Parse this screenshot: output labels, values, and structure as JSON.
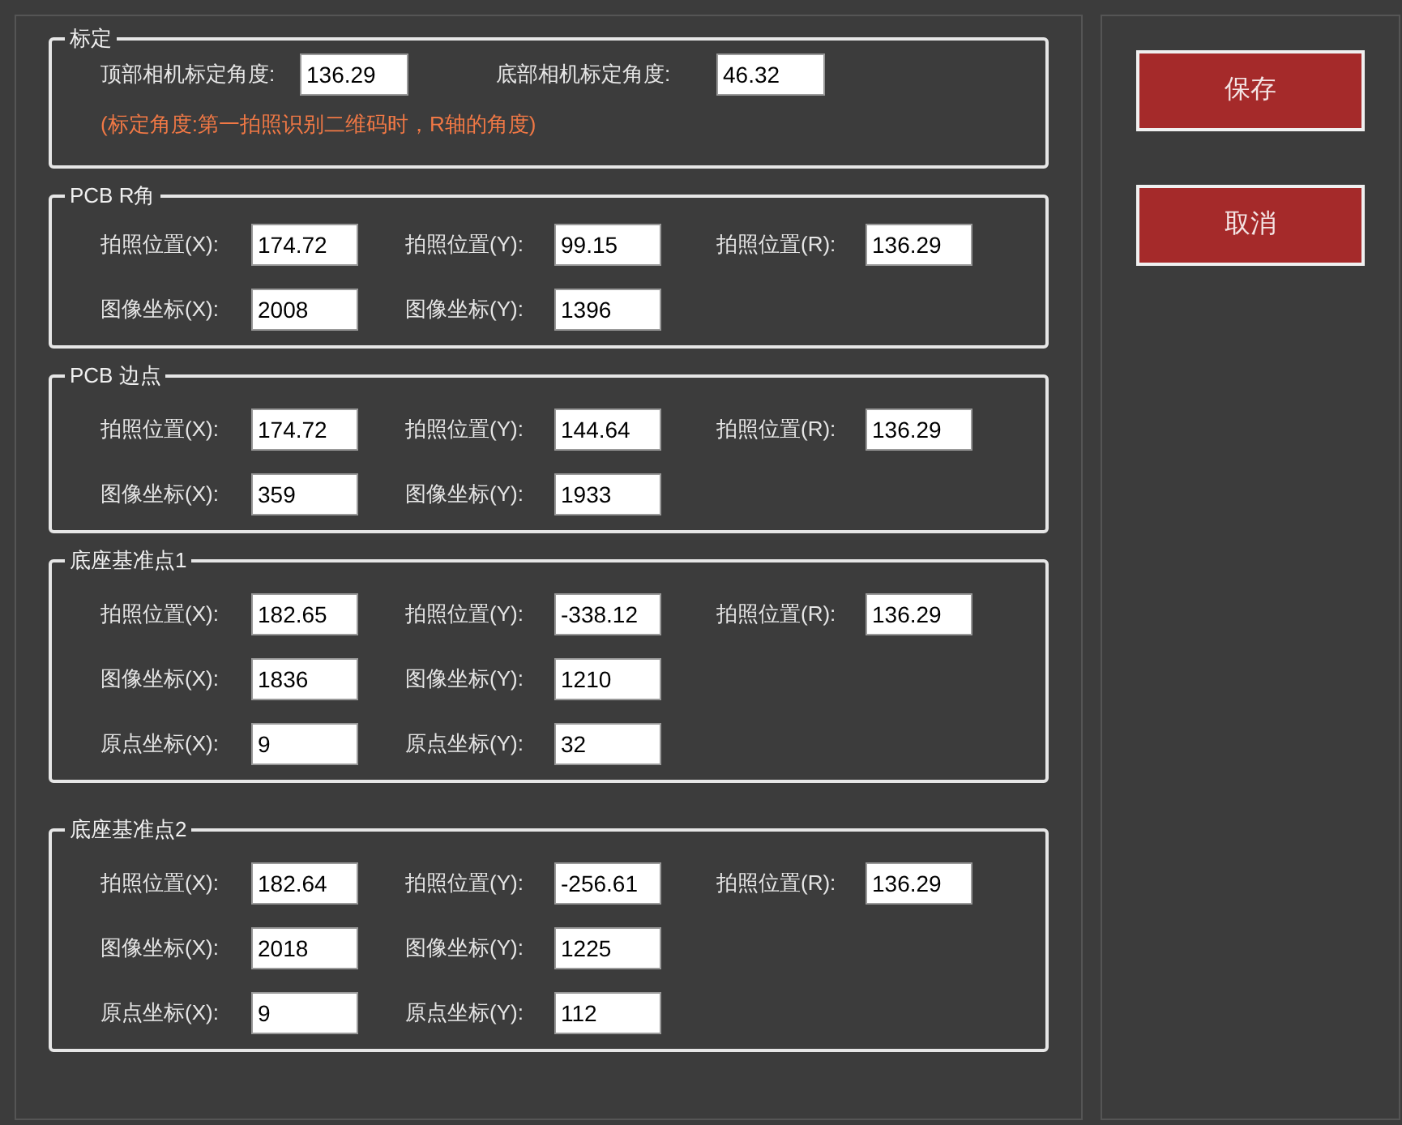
{
  "calibration": {
    "title": "标定",
    "fields": [
      {
        "label": "顶部相机标定角度:",
        "value": "136.29"
      },
      {
        "label": "底部相机标定角度:",
        "value": "46.32"
      }
    ],
    "note": "(标定角度:第一拍照识别二维码时，R轴的角度)"
  },
  "groups": [
    {
      "title": "PCB R角",
      "rows": [
        [
          {
            "label": "拍照位置(X):",
            "value": "174.72"
          },
          {
            "label": "拍照位置(Y):",
            "value": "99.15"
          },
          {
            "label": "拍照位置(R):",
            "value": "136.29"
          }
        ],
        [
          {
            "label": "图像坐标(X):",
            "value": "2008"
          },
          {
            "label": "图像坐标(Y):",
            "value": "1396"
          }
        ]
      ]
    },
    {
      "title": "PCB 边点",
      "rows": [
        [
          {
            "label": "拍照位置(X):",
            "value": "174.72"
          },
          {
            "label": "拍照位置(Y):",
            "value": "144.64"
          },
          {
            "label": "拍照位置(R):",
            "value": "136.29"
          }
        ],
        [
          {
            "label": "图像坐标(X):",
            "value": "359"
          },
          {
            "label": "图像坐标(Y):",
            "value": "1933"
          }
        ]
      ]
    },
    {
      "title": "底座基准点1",
      "rows": [
        [
          {
            "label": "拍照位置(X):",
            "value": "182.65"
          },
          {
            "label": "拍照位置(Y):",
            "value": "-338.12"
          },
          {
            "label": "拍照位置(R):",
            "value": "136.29"
          }
        ],
        [
          {
            "label": "图像坐标(X):",
            "value": "1836"
          },
          {
            "label": "图像坐标(Y):",
            "value": "1210"
          }
        ],
        [
          {
            "label": "原点坐标(X):",
            "value": "9"
          },
          {
            "label": "原点坐标(Y):",
            "value": "32"
          }
        ]
      ]
    },
    {
      "title": "底座基准点2",
      "rows": [
        [
          {
            "label": "拍照位置(X):",
            "value": "182.64"
          },
          {
            "label": "拍照位置(Y):",
            "value": "-256.61"
          },
          {
            "label": "拍照位置(R):",
            "value": "136.29"
          }
        ],
        [
          {
            "label": "图像坐标(X):",
            "value": "2018"
          },
          {
            "label": "图像坐标(Y):",
            "value": "1225"
          }
        ],
        [
          {
            "label": "原点坐标(X):",
            "value": "9"
          },
          {
            "label": "原点坐标(Y):",
            "value": "112"
          }
        ]
      ]
    }
  ],
  "buttons": [
    {
      "label": "保存"
    },
    {
      "label": "取消"
    }
  ]
}
